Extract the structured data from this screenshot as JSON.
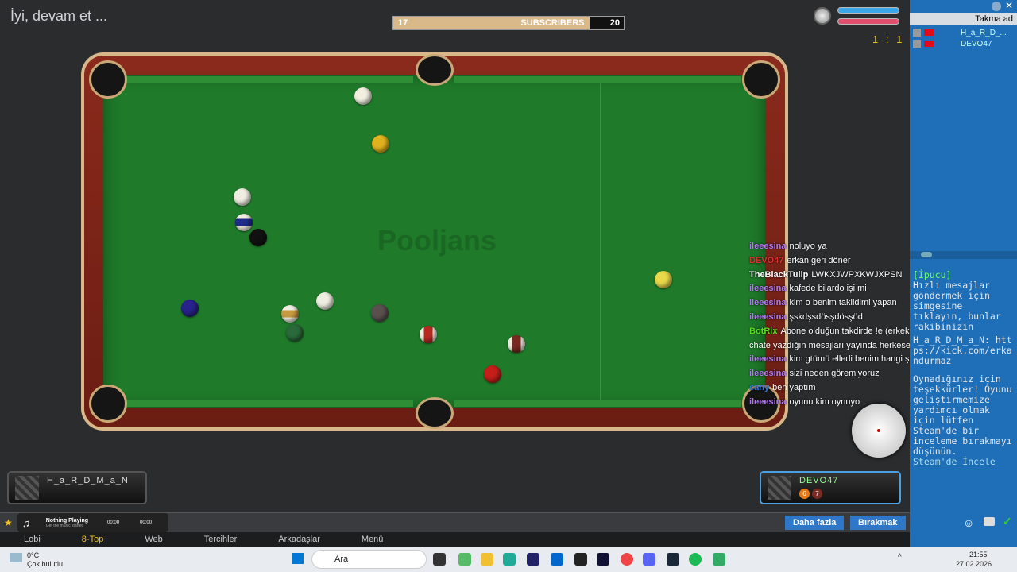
{
  "status": "İyi, devam et ...",
  "subs": {
    "current": "17",
    "label": "SUBSCRIBERS",
    "goal": "20",
    "progress": 0.85
  },
  "score": "1 : 1",
  "table_watermark": "Pooljans",
  "players": {
    "left": "H_a_R_D_M_a_N",
    "right": "DEVO47",
    "right_balls": [
      "6",
      "7"
    ]
  },
  "music": {
    "title": "Nothing Playing",
    "subtitle": "Get the music started",
    "t1": "00:00",
    "t2": "00:00"
  },
  "menu": [
    "Lobi",
    "8-Top",
    "Web",
    "Tercihler",
    "Arkadaşlar",
    "Menü"
  ],
  "buttons": {
    "more": "Daha fazla",
    "leave": "Bırakmak"
  },
  "right": {
    "header": "Takma ad",
    "list": [
      "H_a_R_D_...",
      "DEVO47"
    ]
  },
  "side": {
    "hint_tag": "[İpucu]",
    "hint": "Hızlı mesajlar göndermek için simgesine tıklayın, bunlar rakibinizin",
    "user_line": "H_a_R_D_M_a_N: https://kick.com/erkandurmaz",
    "thanks": "Oynadığınız için teşekkürler! Oyunu geliştirmemize yardımcı olmak için lütfen Steam'de bir inceleme bırakmayı düşünün.",
    "steam_link": "Steam'de İncele"
  },
  "chat": [
    {
      "user": "ileeesina",
      "text": "noluyo ya",
      "color": "#b27cf0"
    },
    {
      "user": "DEVO47",
      "text": "erkan geri döner",
      "color": "#e03030"
    },
    {
      "user": "TheBlackTulip",
      "text": "LWKXJWPXKWJXPSN",
      "color": "#ffffff"
    },
    {
      "user": "ileeesina",
      "text": "kafede bilardo işi mi",
      "color": "#b27cf0"
    },
    {
      "user": "ileeesina",
      "text": "kim o benim taklidimi yapan",
      "color": "#b27cf0"
    },
    {
      "user": "ileeesina",
      "text": "şskdşsdösşdösşöd",
      "color": "#b27cf0"
    },
    {
      "user": "BotRix",
      "text": "Abone olduğun takdirde !e (erkek sesi) ve !k (kadın sesi) ile chate yazdığın mesajları yayında herkese dinletebilirsin! (!e ...)",
      "color": "#55e020"
    },
    {
      "user": "ileeesina",
      "text": "kim gtümü elledi benim hangi şerefsiz o",
      "color": "#b27cf0"
    },
    {
      "user": "ileeesina",
      "text": "sizi neden göremiyoruz",
      "color": "#b27cf0"
    },
    {
      "user": "cany",
      "text": "ben yaptım",
      "color": "#3a78d8"
    },
    {
      "user": "ileeesina",
      "text": "oyunu kim oynuyo",
      "color": "#b27cf0"
    }
  ],
  "taskbar": {
    "weather_temp": "0°C",
    "weather_text": "Çok bulutlu",
    "search": "Ara",
    "time": "21:55",
    "date": "27.02.2026"
  }
}
